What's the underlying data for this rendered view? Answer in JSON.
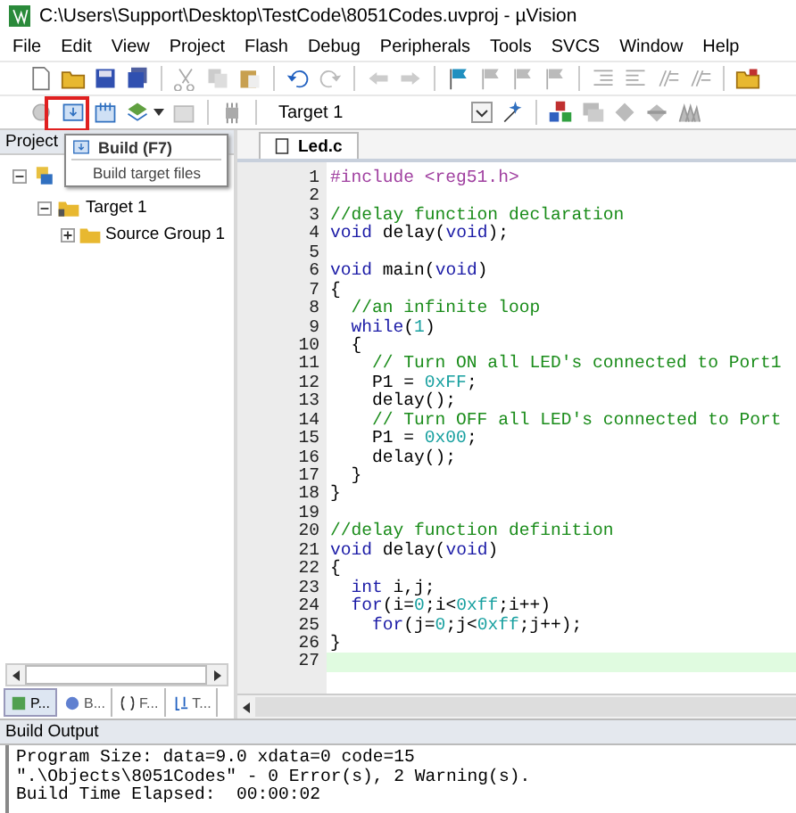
{
  "window": {
    "title": "C:\\Users\\Support\\Desktop\\TestCode\\8051Codes.uvproj - µVision"
  },
  "menu": [
    "File",
    "Edit",
    "View",
    "Project",
    "Flash",
    "Debug",
    "Peripherals",
    "Tools",
    "SVCS",
    "Window",
    "Help"
  ],
  "toolbar": {
    "target": "Target 1"
  },
  "tooltip": {
    "title": "Build (F7)",
    "description": "Build target files"
  },
  "project_panel": {
    "title": "Project",
    "tree": [
      {
        "expanded": true,
        "children": [
          {
            "label": "Target 1",
            "expanded": true,
            "children": [
              {
                "label": "Source Group 1",
                "expanded": false
              }
            ]
          }
        ]
      }
    ],
    "tabs": [
      {
        "label": "P...",
        "selected": true
      },
      {
        "label": "B...",
        "selected": false
      },
      {
        "label": "F...",
        "selected": false
      },
      {
        "label": "T...",
        "selected": false
      }
    ]
  },
  "editor": {
    "tab": "Led.c",
    "lines": [
      {
        "number": "1",
        "current": false,
        "tokens": [
          {
            "kind": "preproc",
            "text": "#include <reg51.h>"
          }
        ]
      },
      {
        "number": "2",
        "current": false
      },
      {
        "number": "3",
        "current": false,
        "tokens": [
          {
            "kind": "comment",
            "text": "//delay function declaration"
          }
        ]
      },
      {
        "number": "4",
        "current": false,
        "tokens": [
          {
            "kind": "keyword",
            "text": "void"
          },
          {
            "kind": "plain",
            "text": " delay("
          },
          {
            "kind": "keyword",
            "text": "void"
          },
          {
            "kind": "plain",
            "text": ");"
          }
        ]
      },
      {
        "number": "5",
        "current": false
      },
      {
        "number": "6",
        "current": false,
        "tokens": [
          {
            "kind": "keyword",
            "text": "void"
          },
          {
            "kind": "plain",
            "text": " main("
          },
          {
            "kind": "keyword",
            "text": "void"
          },
          {
            "kind": "plain",
            "text": ")"
          }
        ]
      },
      {
        "number": "7",
        "current": false,
        "tokens": [
          {
            "kind": "plain",
            "text": "{"
          }
        ]
      },
      {
        "number": "8",
        "current": false,
        "tokens": [
          {
            "kind": "comment",
            "text": "  //an infinite loop"
          }
        ]
      },
      {
        "number": "9",
        "current": false,
        "tokens": [
          {
            "kind": "keyword",
            "text": "  while"
          },
          {
            "kind": "plain",
            "text": "("
          },
          {
            "kind": "number",
            "text": "1"
          },
          {
            "kind": "plain",
            "text": ")"
          }
        ]
      },
      {
        "number": "10",
        "current": false,
        "tokens": [
          {
            "kind": "plain",
            "text": "  {"
          }
        ]
      },
      {
        "number": "11",
        "current": false,
        "tokens": [
          {
            "kind": "comment",
            "text": "    // Turn ON all LED's connected to Port1"
          }
        ]
      },
      {
        "number": "12",
        "current": false,
        "tokens": [
          {
            "kind": "plain",
            "text": "    P1 = "
          },
          {
            "kind": "number",
            "text": "0xFF"
          },
          {
            "kind": "plain",
            "text": ";"
          }
        ]
      },
      {
        "number": "13",
        "current": false,
        "tokens": [
          {
            "kind": "plain",
            "text": "    delay();"
          }
        ]
      },
      {
        "number": "14",
        "current": false,
        "tokens": [
          {
            "kind": "comment",
            "text": "    // Turn OFF all LED's connected to Port"
          }
        ]
      },
      {
        "number": "15",
        "current": false,
        "tokens": [
          {
            "kind": "plain",
            "text": "    P1 = "
          },
          {
            "kind": "number",
            "text": "0x00"
          },
          {
            "kind": "plain",
            "text": ";"
          }
        ]
      },
      {
        "number": "16",
        "current": false,
        "tokens": [
          {
            "kind": "plain",
            "text": "    delay();"
          }
        ]
      },
      {
        "number": "17",
        "current": false,
        "tokens": [
          {
            "kind": "plain",
            "text": "  }"
          }
        ]
      },
      {
        "number": "18",
        "current": false,
        "tokens": [
          {
            "kind": "plain",
            "text": "}"
          }
        ]
      },
      {
        "number": "19",
        "current": false
      },
      {
        "number": "20",
        "current": false,
        "tokens": [
          {
            "kind": "comment",
            "text": "//delay function definition"
          }
        ]
      },
      {
        "number": "21",
        "current": false,
        "tokens": [
          {
            "kind": "keyword",
            "text": "void"
          },
          {
            "kind": "plain",
            "text": " delay("
          },
          {
            "kind": "keyword",
            "text": "void"
          },
          {
            "kind": "plain",
            "text": ")"
          }
        ]
      },
      {
        "number": "22",
        "current": false,
        "tokens": [
          {
            "kind": "plain",
            "text": "{"
          }
        ]
      },
      {
        "number": "23",
        "current": false,
        "tokens": [
          {
            "kind": "keyword",
            "text": "  int"
          },
          {
            "kind": "plain",
            "text": " i,j;"
          }
        ]
      },
      {
        "number": "24",
        "current": false,
        "tokens": [
          {
            "kind": "keyword",
            "text": "  for"
          },
          {
            "kind": "plain",
            "text": "(i="
          },
          {
            "kind": "number",
            "text": "0"
          },
          {
            "kind": "plain",
            "text": ";i<"
          },
          {
            "kind": "number",
            "text": "0xff"
          },
          {
            "kind": "plain",
            "text": ";i++)"
          }
        ]
      },
      {
        "number": "25",
        "current": false,
        "tokens": [
          {
            "kind": "keyword",
            "text": "    for"
          },
          {
            "kind": "plain",
            "text": "(j="
          },
          {
            "kind": "number",
            "text": "0"
          },
          {
            "kind": "plain",
            "text": ";j<"
          },
          {
            "kind": "number",
            "text": "0xff"
          },
          {
            "kind": "plain",
            "text": ";j++);"
          }
        ]
      },
      {
        "number": "26",
        "current": false,
        "tokens": [
          {
            "kind": "plain",
            "text": "}"
          }
        ]
      },
      {
        "number": "27",
        "current": true
      }
    ]
  },
  "build_output": {
    "title": "Build Output",
    "lines": [
      "Program Size: data=9.0 xdata=0 code=15",
      "\".\\Objects\\8051Codes\" - 0 Error(s), 2 Warning(s).",
      "Build Time Elapsed:  00:00:02"
    ]
  }
}
